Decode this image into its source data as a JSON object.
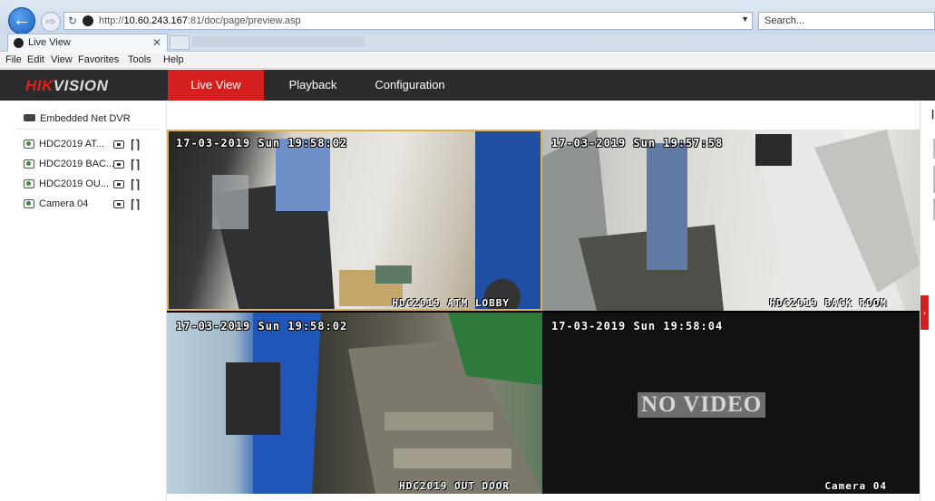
{
  "browser": {
    "url_prefix": "http://",
    "url_host": "10.60.243.167",
    "url_path": ":81/doc/page/preview.asp",
    "search_placeholder": "Search...",
    "tab_title": "Live View",
    "back_icon": "arrow-left-icon",
    "forward_icon": "arrow-right-icon",
    "menu": [
      "File",
      "Edit",
      "View",
      "Favorites",
      "Tools",
      "Help"
    ]
  },
  "app": {
    "logo_hik": "HIK",
    "logo_vision": "VISION",
    "brand_color": "#d61f1f",
    "nav": [
      {
        "label": "Live View",
        "active": true
      },
      {
        "label": "Playback",
        "active": false
      },
      {
        "label": "Configuration",
        "active": false
      }
    ]
  },
  "device_tree": {
    "root_label": "Embedded Net DVR",
    "cameras": [
      {
        "label": "HDC2019 AT..."
      },
      {
        "label": "HDC2019 BAC..."
      },
      {
        "label": "HDC2019 OU..."
      },
      {
        "label": "Camera 04"
      }
    ]
  },
  "channels": [
    {
      "timestamp": "17-03-2019 Sun 19:58:02",
      "name": "HDC2019 ATM LOBBY",
      "selected": true
    },
    {
      "timestamp": "17-03-2019 Sun 19:57:58",
      "name": "HDC2019 BACK ROOM",
      "selected": false
    },
    {
      "timestamp": "17-03-2019 Sun 19:58:02",
      "name": "HDC2019 OUT DOOR",
      "selected": false
    },
    {
      "timestamp": "17-03-2019 Sun 19:58:04",
      "name": "Camera 04",
      "selected": false,
      "status": "NO VIDEO"
    }
  ]
}
